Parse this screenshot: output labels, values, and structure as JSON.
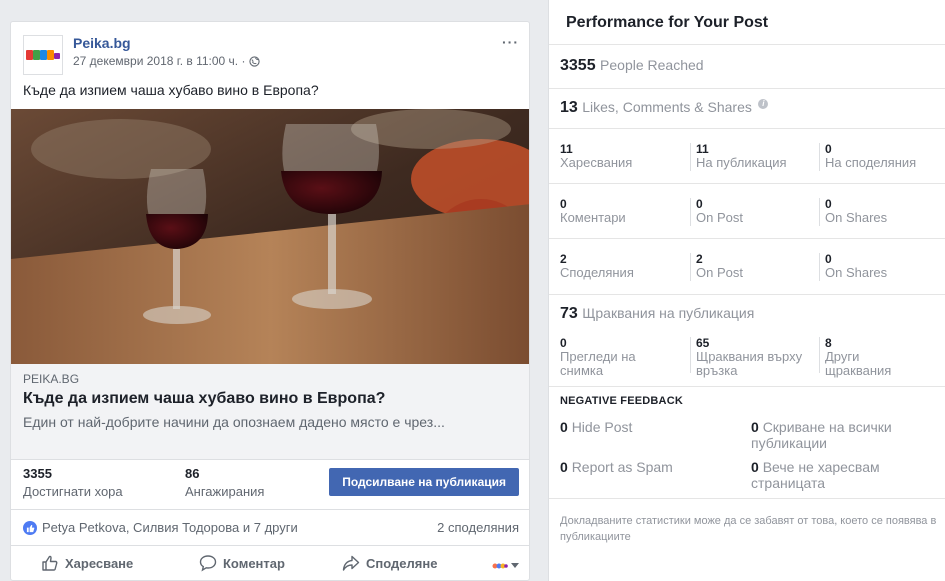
{
  "post": {
    "page_name": "Peika.bg",
    "timestamp": "27 декември 2018 г. в 11:00 ч. ·",
    "text": "Къде да изпием чаша хубаво вино в Европа?",
    "more_icon": "···",
    "link": {
      "domain": "PEIKA.BG",
      "title": "Къде да изпием чаша хубаво вино в Европа?",
      "description": "Един от най-добрите начини да опознаем дадено място е чрез..."
    },
    "stats": {
      "reached_value": "3355",
      "reached_label": "Достигнати хора",
      "engagements_value": "86",
      "engagements_label": "Ангажирания",
      "boost_label": "Подсилване на публикация"
    },
    "reactions": {
      "reactors": "Petya Petkova, Силвия Тодорова и 7 други",
      "shares": "2 споделяния"
    },
    "actions": {
      "like": "Харесване",
      "comment": "Коментар",
      "share": "Споделяне"
    }
  },
  "performance": {
    "title": "Performance for Your Post",
    "reach_value": "3355",
    "reach_label": "People Reached",
    "engagement_value": "13",
    "engagement_label": "Likes, Comments & Shares",
    "likes_row": [
      {
        "value": "11",
        "label": "Харесвания"
      },
      {
        "value": "11",
        "label": "На публикация"
      },
      {
        "value": "0",
        "label": "На споделяния"
      }
    ],
    "comments_row": [
      {
        "value": "0",
        "label": "Коментари"
      },
      {
        "value": "0",
        "label": "On Post"
      },
      {
        "value": "0",
        "label": "On Shares"
      }
    ],
    "shares_row": [
      {
        "value": "2",
        "label": "Споделяния"
      },
      {
        "value": "2",
        "label": "On Post"
      },
      {
        "value": "0",
        "label": "On Shares"
      }
    ],
    "clicks_value": "73",
    "clicks_label": "Щраквания на публикация",
    "clicks_row": [
      {
        "value": "0",
        "label": "Прегледи на снимка"
      },
      {
        "value": "65",
        "label": "Щраквания върху връзка"
      },
      {
        "value": "8",
        "label": "Други щраквания"
      }
    ],
    "negative": {
      "title": "NEGATIVE FEEDBACK",
      "hide_post_value": "0",
      "hide_post_label": "Hide Post",
      "hide_all_value": "0",
      "hide_all_label": "Скриване на всички публикации",
      "spam_value": "0",
      "spam_label": "Report as Spam",
      "unlike_value": "0",
      "unlike_label": "Вече не харесвам страницата"
    },
    "footnote": "Докладваните статистики може да се забавят от това, което се появява в публикациите"
  },
  "colors": {
    "brand_blue": "#4267b2",
    "link_blue": "#365899",
    "muted_text": "#90949c"
  }
}
